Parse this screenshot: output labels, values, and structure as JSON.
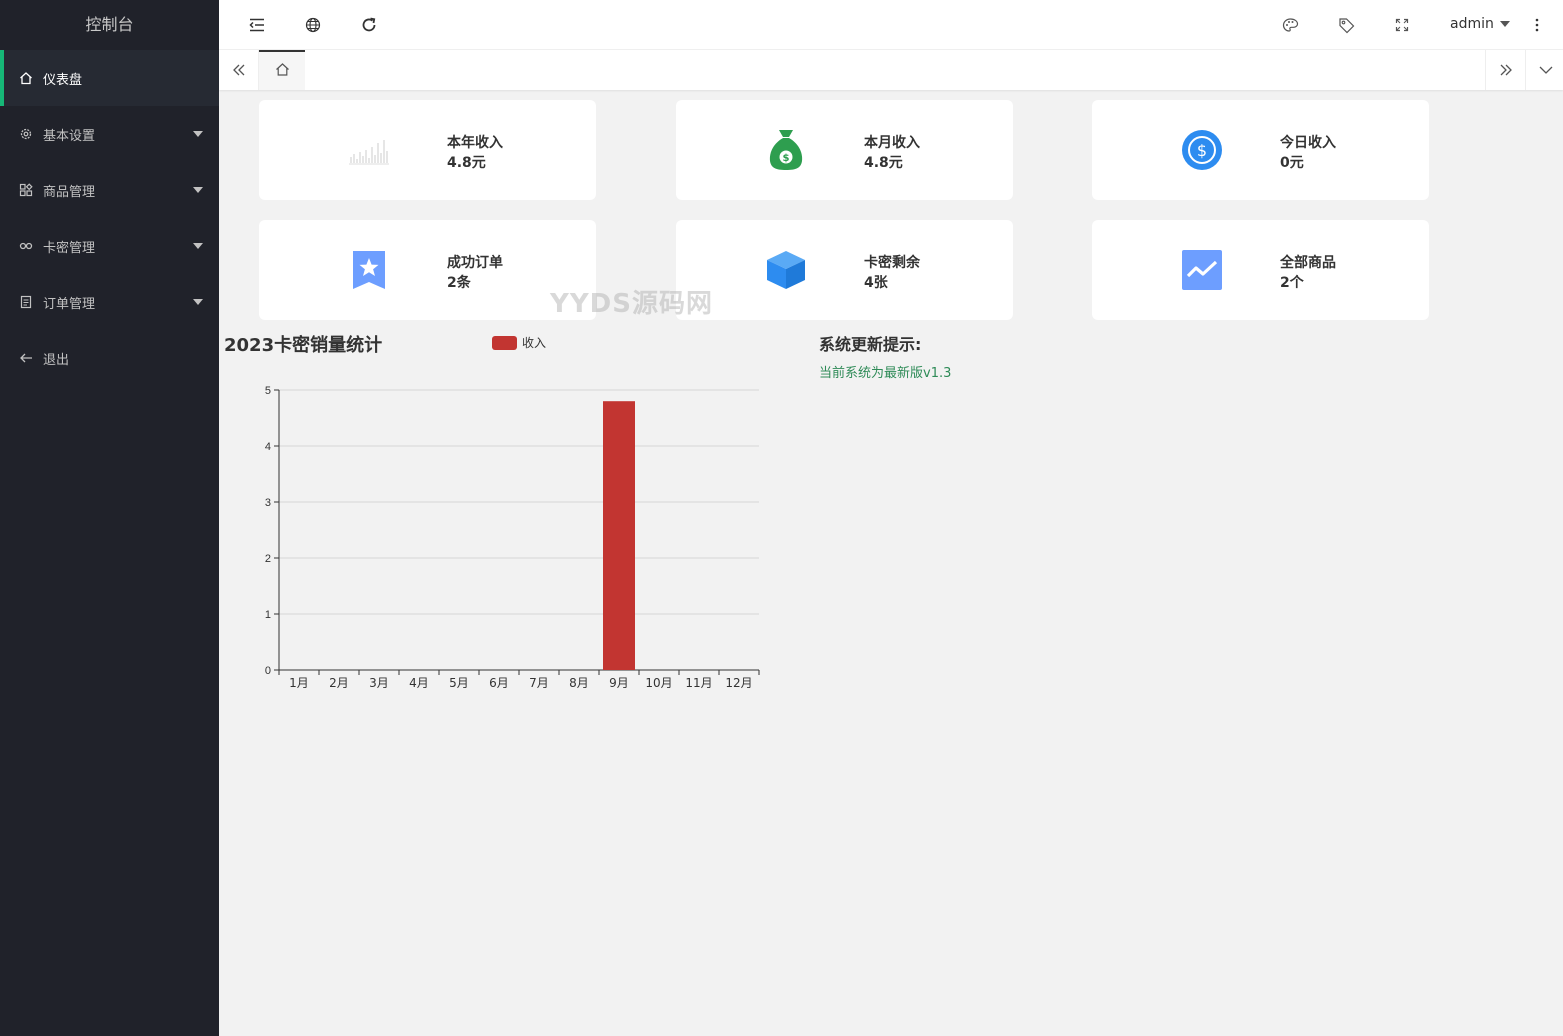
{
  "sidebar": {
    "logo": "控制台",
    "items": [
      {
        "label": "仪表盘",
        "icon": "home-icon",
        "active": true
      },
      {
        "label": "基本设置",
        "icon": "gear-icon",
        "expandable": true
      },
      {
        "label": "商品管理",
        "icon": "apps-icon",
        "expandable": true
      },
      {
        "label": "卡密管理",
        "icon": "link-icon",
        "expandable": true
      },
      {
        "label": "订单管理",
        "icon": "list-icon",
        "expandable": true
      },
      {
        "label": "退出",
        "icon": "arrow-left-icon"
      }
    ]
  },
  "header": {
    "user": "admin",
    "left_icons": [
      "menu-fold-icon",
      "globe-icon",
      "refresh-icon"
    ],
    "right_icons": [
      "palette-icon",
      "tag-icon",
      "fullscreen-icon",
      "more-icon"
    ]
  },
  "tabs": {
    "home_icon": "home-icon"
  },
  "cards": [
    {
      "title": "本年收入",
      "value": "4.8元",
      "icon": "chart-icon",
      "color": "#dddddd"
    },
    {
      "title": "本月收入",
      "value": "4.8元",
      "icon": "money-bag-icon",
      "color": "#2e9e4f"
    },
    {
      "title": "今日收入",
      "value": "0元",
      "icon": "dollar-circle-icon",
      "color": "#2d8cf0"
    },
    {
      "title": "成功订单",
      "value": "2条",
      "icon": "star-bookmark-icon",
      "color": "#6d9eff"
    },
    {
      "title": "卡密剩余",
      "value": "4张",
      "icon": "cube-icon",
      "color": "#2d8cf0"
    },
    {
      "title": "全部商品",
      "value": "2个",
      "icon": "trend-icon",
      "color": "#6d9eff"
    }
  ],
  "watermark": "YYDS源码网",
  "chart_data": {
    "type": "bar",
    "title": "2023卡密销量统计",
    "categories": [
      "1月",
      "2月",
      "3月",
      "4月",
      "5月",
      "6月",
      "7月",
      "8月",
      "9月",
      "10月",
      "11月",
      "12月"
    ],
    "series": [
      {
        "name": "收入",
        "values": [
          0,
          0,
          0,
          0,
          0,
          0,
          0,
          0,
          4.8,
          0,
          0,
          0
        ],
        "color": "#c23531"
      }
    ],
    "ylim": [
      0,
      5
    ],
    "yticks": [
      0,
      1,
      2,
      3,
      4,
      5
    ],
    "grid": true,
    "legend": "top-center"
  },
  "notice": {
    "title": "系统更新提示:",
    "text": "当前系统为最新版v1.3"
  }
}
